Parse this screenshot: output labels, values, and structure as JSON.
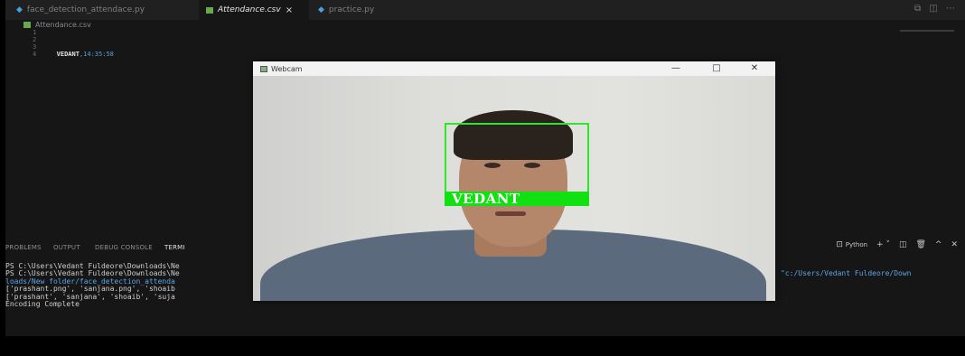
{
  "editor": {
    "tabs": [
      {
        "label": "face_detection_attendace.py",
        "icon": "python-icon"
      },
      {
        "label": "Attendance.csv",
        "icon": "csv-icon",
        "close": "×"
      },
      {
        "label": "practice.py",
        "icon": "python-icon"
      }
    ],
    "breadcrumb": "Attendance.csv",
    "line_numbers": [
      "1",
      "2",
      "3",
      "4"
    ],
    "line4_name": "VEDANT",
    "line4_time": ",14:35:58"
  },
  "panel": {
    "tabs": [
      "PROBLEMS",
      "OUTPUT",
      "DEBUG CONSOLE",
      "TERMI"
    ],
    "python_label": "Python"
  },
  "terminal": {
    "lines": [
      "PS C:\\Users\\Vedant Fuldeore\\Downloads\\Ne",
      "PS C:\\Users\\Vedant Fuldeore\\Downloads\\Ne",
      "loads/New folder/face_detection_attenda",
      "['prashant.png', 'sanjana.png', 'shoaib",
      "['prashant', 'sanjana', 'shoaib', 'suja",
      "Encoding Complete"
    ],
    "right_text": "\"c:/Users/Vedant Fuldeore/Down"
  },
  "webcam": {
    "title": "Webcam",
    "minimize": "—",
    "maximize": "□",
    "close": "✕",
    "face_label": "VEDANT"
  },
  "colors": {
    "editor_bg": "#161616",
    "face_box": "#2ee62e",
    "number": "#5a9fd4"
  }
}
